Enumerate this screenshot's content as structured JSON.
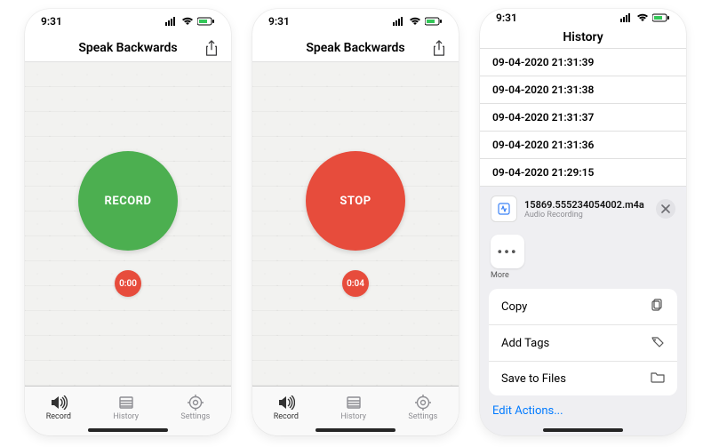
{
  "status": {
    "time": "9:31"
  },
  "screen1": {
    "title": "Speak Backwards",
    "button_label": "RECORD",
    "timer": "0:00",
    "tabs": {
      "record": "Record",
      "history": "History",
      "settings": "Settings"
    }
  },
  "screen2": {
    "title": "Speak Backwards",
    "button_label": "STOP",
    "timer": "0:04",
    "tabs": {
      "record": "Record",
      "history": "History",
      "settings": "Settings"
    }
  },
  "screen3": {
    "title": "History",
    "items": [
      "09-04-2020 21:31:39",
      "09-04-2020 21:31:38",
      "09-04-2020 21:31:37",
      "09-04-2020 21:31:36",
      "09-04-2020 21:29:15"
    ],
    "share": {
      "filename": "15869.555234054002.m4a",
      "subtitle": "Audio Recording",
      "more_glyph": "•••",
      "more_label": "More",
      "actions": {
        "copy": "Copy",
        "add_tags": "Add Tags",
        "save_to_files": "Save to Files"
      },
      "edit_actions": "Edit Actions..."
    }
  }
}
